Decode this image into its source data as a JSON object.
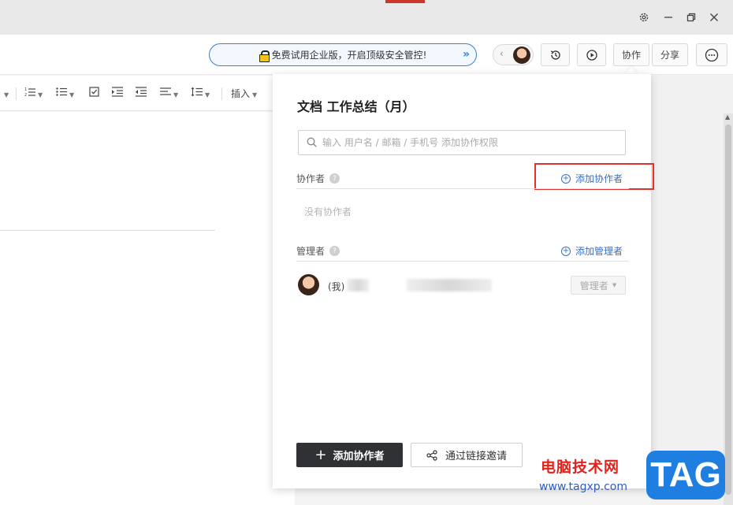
{
  "titlebar": {
    "settings_icon": "gear-icon",
    "minimize_icon": "minimize-icon",
    "restore_icon": "restore-icon",
    "close_icon": "close-icon"
  },
  "topbar": {
    "promo_text": "免费试用企业版，开启顶级安全管控!",
    "history_icon": "history-icon",
    "play_icon": "play-icon",
    "collaborate_label": "协作",
    "share_label": "分享",
    "more_icon": "more-icon"
  },
  "toolbar": {
    "insert_label": "插入"
  },
  "panel": {
    "title": "文档 工作总结（月）",
    "search_placeholder": "输入 用户名 / 邮箱 / 手机号 添加协作权限",
    "collaborators_label": "协作者",
    "add_collaborator_link": "添加协作者",
    "no_collaborators_text": "没有协作者",
    "managers_label": "管理者",
    "add_manager_link": "添加管理者",
    "members": [
      {
        "name_prefix": "(我)",
        "role": "管理者"
      }
    ],
    "add_collaborator_button": "添加协作者",
    "invite_link_button": "通过链接邀请",
    "help_mark": "?"
  },
  "watermark": {
    "site_name": "电脑技术网",
    "url": "www.tagxp.com",
    "badge": "TAG"
  },
  "colors": {
    "accent_blue": "#3a6fc5",
    "highlight_red": "#e0322b",
    "dark_button": "#2f3135"
  }
}
